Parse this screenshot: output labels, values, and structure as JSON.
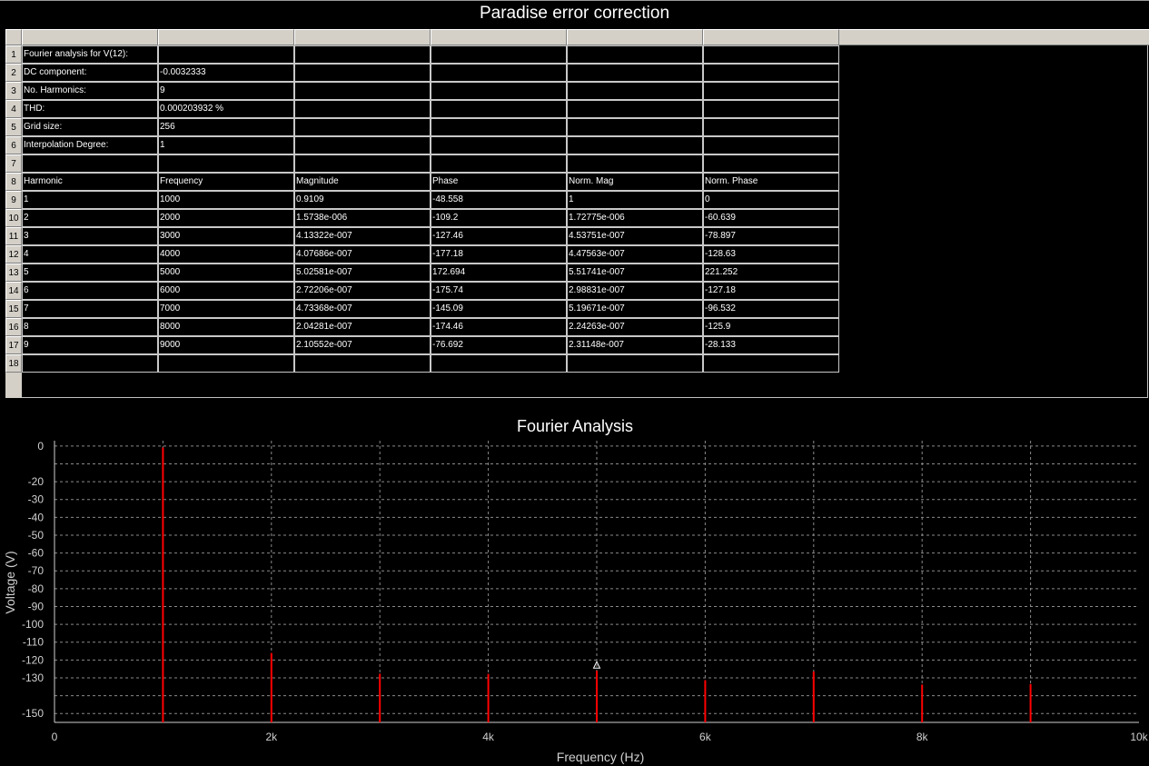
{
  "window": {
    "title": "Paradise error correction"
  },
  "table": {
    "rows": [
      [
        "Fourier analysis for V(12):",
        "",
        "",
        "",
        "",
        ""
      ],
      [
        "DC component:",
        "-0.0032333",
        "",
        "",
        "",
        ""
      ],
      [
        "No. Harmonics:",
        "9",
        "",
        "",
        "",
        ""
      ],
      [
        "THD:",
        "0.000203932 %",
        "",
        "",
        "",
        ""
      ],
      [
        "Grid size:",
        "256",
        "",
        "",
        "",
        ""
      ],
      [
        "Interpolation Degree:",
        "1",
        "",
        "",
        "",
        ""
      ],
      [
        "",
        "",
        "",
        "",
        "",
        ""
      ],
      [
        "Harmonic",
        "Frequency",
        "Magnitude",
        "Phase",
        "Norm. Mag",
        "Norm. Phase"
      ],
      [
        "1",
        "1000",
        "0.9109",
        "-48.558",
        "1",
        "0"
      ],
      [
        "2",
        "2000",
        "1.5738e-006",
        "-109.2",
        "1.72775e-006",
        "-60.639"
      ],
      [
        "3",
        "3000",
        "4.13322e-007",
        "-127.46",
        "4.53751e-007",
        "-78.897"
      ],
      [
        "4",
        "4000",
        "4.07686e-007",
        "-177.18",
        "4.47563e-007",
        "-128.63"
      ],
      [
        "5",
        "5000",
        "5.02581e-007",
        "172.694",
        "5.51741e-007",
        "221.252"
      ],
      [
        "6",
        "6000",
        "2.72206e-007",
        "-175.74",
        "2.98831e-007",
        "-127.18"
      ],
      [
        "7",
        "7000",
        "4.73368e-007",
        "-145.09",
        "5.19671e-007",
        "-96.532"
      ],
      [
        "8",
        "8000",
        "2.04281e-007",
        "-174.46",
        "2.24263e-007",
        "-125.9"
      ],
      [
        "9",
        "9000",
        "2.10552e-007",
        "-76.692",
        "2.31148e-007",
        "-28.133"
      ],
      [
        "",
        "",
        "",
        "",
        "",
        ""
      ]
    ],
    "row_numbers": [
      "1",
      "2",
      "3",
      "4",
      "5",
      "6",
      "7",
      "8",
      "9",
      "10",
      "11",
      "12",
      "13",
      "14",
      "15",
      "16",
      "17",
      "18"
    ]
  },
  "chart_data": {
    "type": "bar",
    "title": "Fourier Analysis",
    "xlabel": "Frequency (Hz)",
    "ylabel": "Voltage (V)",
    "xlim": [
      0,
      10000
    ],
    "ylim": [
      -155,
      3
    ],
    "x_ticks": [
      0,
      2000,
      4000,
      6000,
      8000,
      10000
    ],
    "x_tick_labels": [
      "0",
      "2k",
      "4k",
      "6k",
      "8k",
      "10k"
    ],
    "y_ticks": [
      0,
      -20,
      -30,
      -40,
      -50,
      -60,
      -70,
      -80,
      -90,
      -100,
      -110,
      -120,
      -130,
      -150
    ],
    "y_tick_labels": [
      "0",
      "-20",
      "-30",
      "-40",
      "-50",
      "-60",
      "-70",
      "-80",
      "-90",
      "-100",
      "-110",
      "-120",
      "-130",
      "-150"
    ],
    "grid": true,
    "bar_color": "#ff0000",
    "series": [
      {
        "x": [
          1000,
          2000,
          3000,
          4000,
          5000,
          6000,
          7000,
          8000,
          9000
        ],
        "values": [
          -0.8,
          -116.1,
          -127.7,
          -127.8,
          -126.0,
          -131.3,
          -126.5,
          -133.8,
          -133.5
        ]
      }
    ],
    "marker": {
      "x": 5000,
      "y": -123,
      "symbol": "triangle"
    }
  }
}
